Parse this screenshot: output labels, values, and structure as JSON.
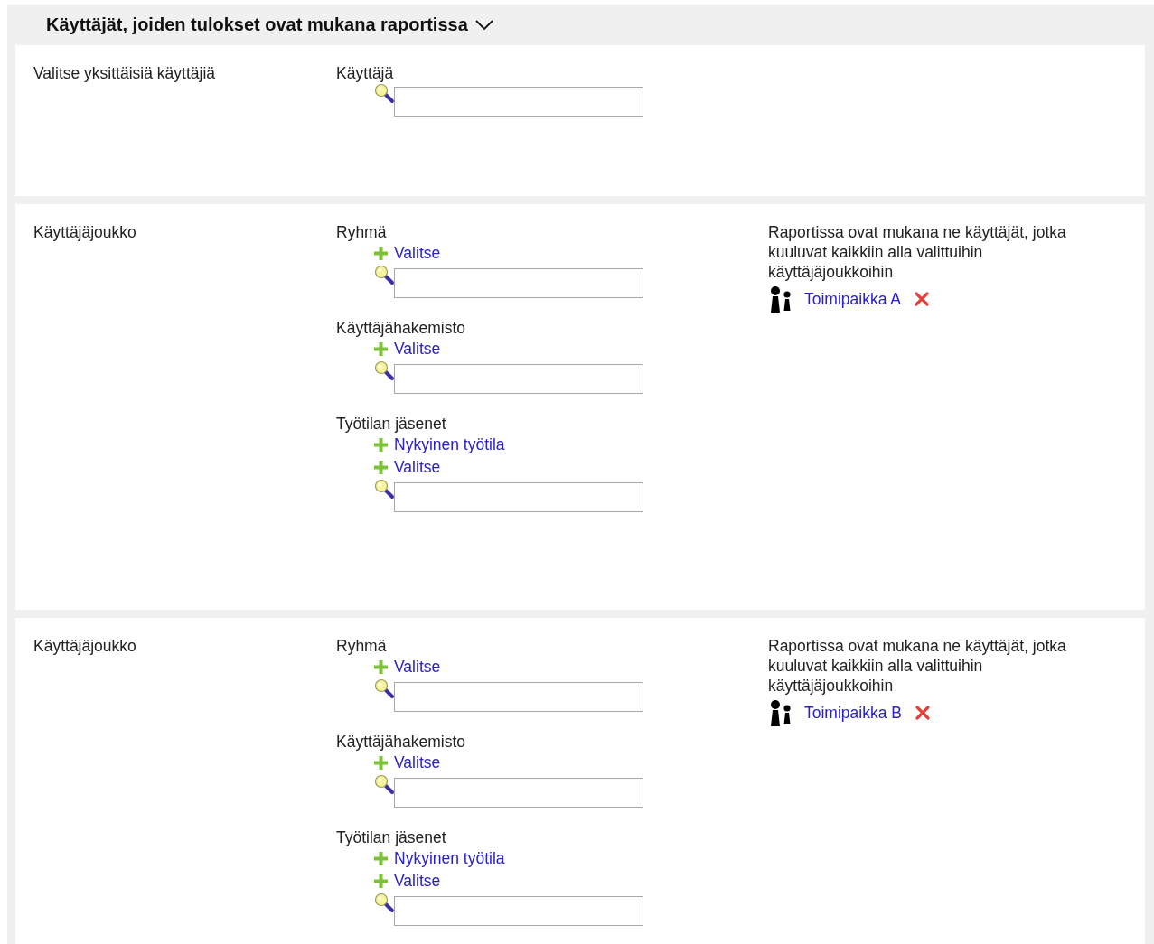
{
  "header": {
    "title": "Käyttäjät, joiden tulokset ovat mukana raportissa",
    "expanded": true
  },
  "sections": [
    {
      "kind": "single",
      "label": "Valitse yksittäisiä käyttäjiä",
      "fields": [
        {
          "label": "Käyttäjä"
        }
      ]
    },
    {
      "kind": "set",
      "label": "Käyttäjäjoukko",
      "fields": [
        {
          "label": "Ryhmä",
          "actions": [
            "Valitse"
          ]
        },
        {
          "label": "Käyttäjähakemisto",
          "actions": [
            "Valitse"
          ]
        },
        {
          "label": "Työtilan jäsenet",
          "actions": [
            "Nykyinen työtila",
            "Valitse"
          ]
        }
      ],
      "note": "Raportissa ovat mukana ne käyttäjät, jotka kuuluvat kaikkiin alla valittuihin käyttäjäjoukkoihin",
      "selected": [
        {
          "name": "Toimipaikka A"
        }
      ]
    },
    {
      "kind": "set",
      "label": "Käyttäjäjoukko",
      "fields": [
        {
          "label": "Ryhmä",
          "actions": [
            "Valitse"
          ]
        },
        {
          "label": "Käyttäjähakemisto",
          "actions": [
            "Valitse"
          ]
        },
        {
          "label": "Työtilan jäsenet",
          "actions": [
            "Nykyinen työtila",
            "Valitse"
          ]
        }
      ],
      "note": "Raportissa ovat mukana ne käyttäjät, jotka kuuluvat kaikkiin alla valittuihin käyttäjäjoukkoihin",
      "selected": [
        {
          "name": "Toimipaikka B"
        }
      ]
    }
  ]
}
